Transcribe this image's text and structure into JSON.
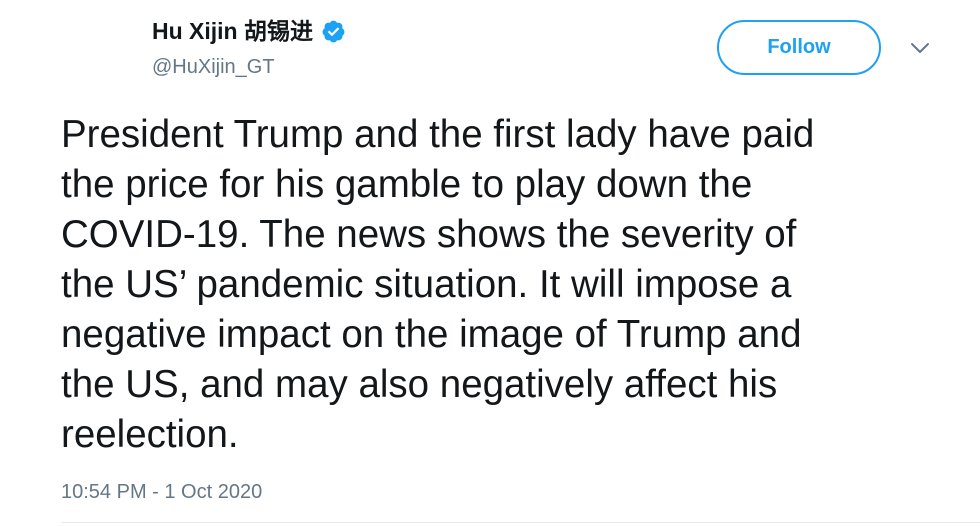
{
  "author": {
    "name": "Hu Xijin 胡锡进",
    "handle": "@HuXijin_GT",
    "verified": true
  },
  "follow_button": {
    "label": "Follow"
  },
  "menu": {
    "icon": "chevron-down-icon"
  },
  "tweet": {
    "lines": [
      "President Trump and the first lady have paid",
      "the price for his gamble to play down the",
      "COVID-19. The news shows the severity of",
      "the US’ pandemic situation. It will impose a",
      "negative impact on the image of Trump and",
      "the US, and may also negatively affect his",
      "reelection."
    ],
    "timestamp": "10:54 PM - 1 Oct 2020"
  },
  "colors": {
    "accent": "#1da1f2",
    "text": "#14171a",
    "secondary_text": "#657786"
  }
}
